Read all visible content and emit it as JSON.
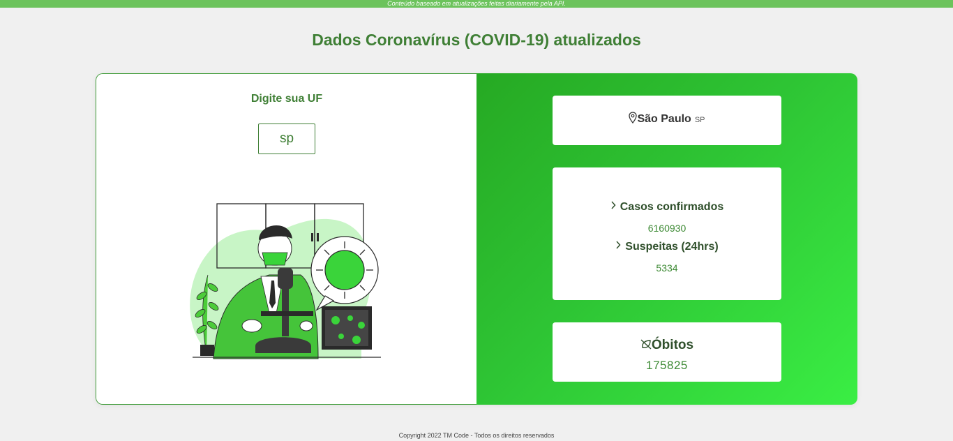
{
  "banner": {
    "text": "Conteúdo baseado em atualizações feitas diariamente pela API."
  },
  "header": {
    "title": "Dados Coronavírus (COVID-19) atualizados"
  },
  "search": {
    "label": "Digite sua UF",
    "value": "sp"
  },
  "location": {
    "state": "São Paulo",
    "uf": "SP",
    "icon": "map-pin-icon"
  },
  "stats": {
    "confirmed_label": "Casos confirmados",
    "confirmed_value": "6160930",
    "suspects_label": "Suspeitas (24hrs)",
    "suspects_value": "5334",
    "deaths_label": "Óbitos",
    "deaths_value": "175825",
    "deaths_icon": "leaf-off-icon",
    "item_icon": "chevron-right-icon"
  },
  "footer": {
    "text": "Copyright 2022 TM Code - Todos os direitos reservados"
  },
  "colors": {
    "brand_green": "#3f7f35",
    "accent_green": "#2ec434",
    "banner_green": "#6cc35c"
  }
}
